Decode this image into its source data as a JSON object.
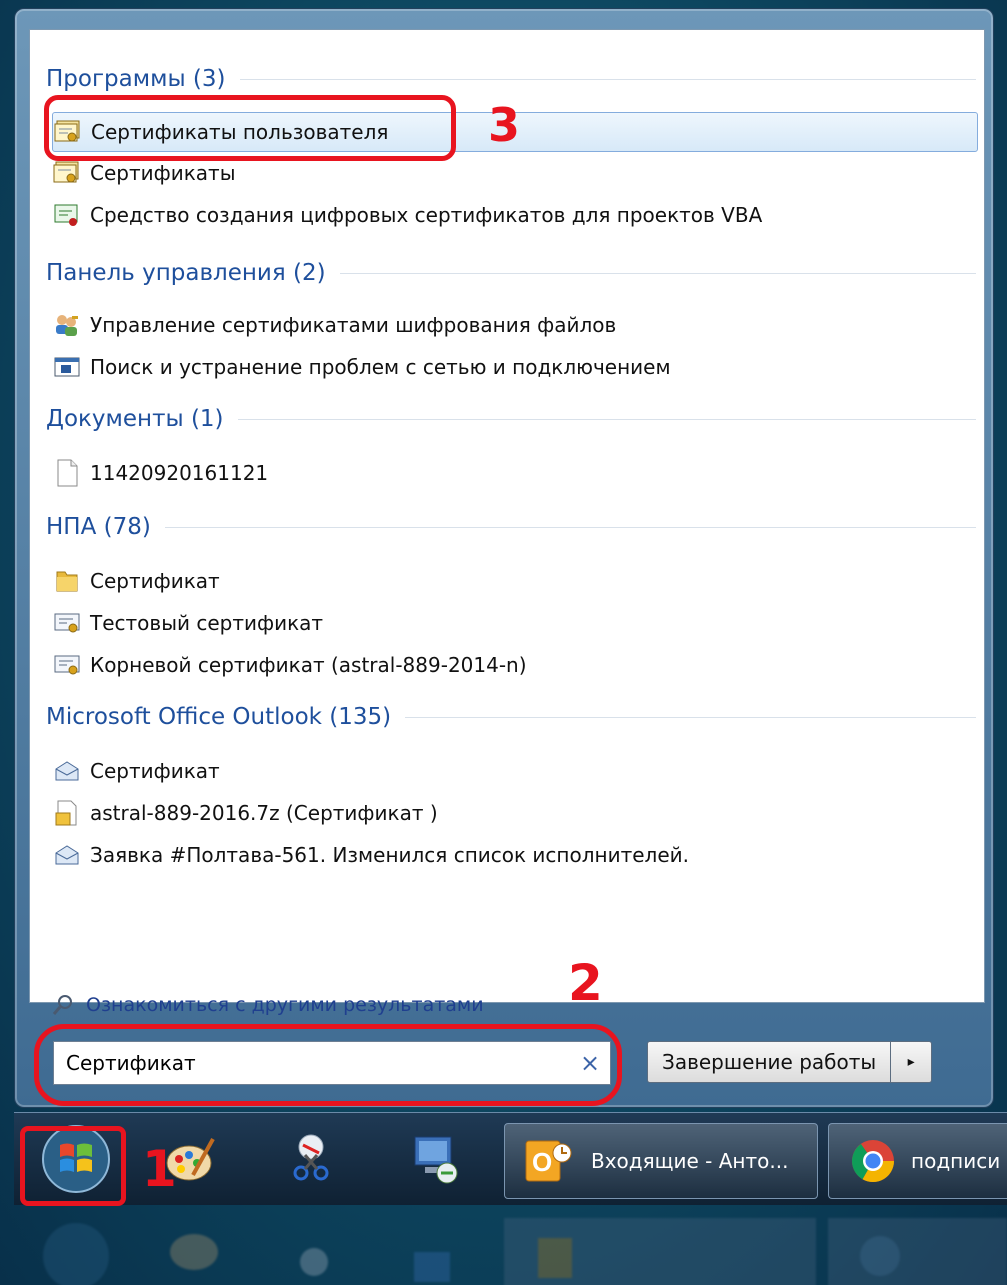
{
  "groups": [
    {
      "heading": "Программы (3)",
      "items": [
        {
          "label": "Сертификаты пользователя",
          "icon": "certificate-folder-icon",
          "selected": true
        },
        {
          "label": "Сертификаты",
          "icon": "certificate-folder-icon"
        },
        {
          "label": "Средство создания цифровых сертификатов для проектов VBA",
          "icon": "digital-certificate-icon"
        }
      ]
    },
    {
      "heading": "Панель управления (2)",
      "items": [
        {
          "label": "Управление сертификатами шифрования файлов",
          "icon": "users-key-icon"
        },
        {
          "label": "Поиск и устранение проблем с сетью и подключением",
          "icon": "network-troubleshoot-icon"
        }
      ]
    },
    {
      "heading": "Документы (1)",
      "items": [
        {
          "label": "11420920161121",
          "icon": "document-icon"
        }
      ]
    },
    {
      "heading": "НПА (78)",
      "items": [
        {
          "label": "Сертификат",
          "icon": "folder-icon"
        },
        {
          "label": "Тестовый сертификат",
          "icon": "certificate-icon"
        },
        {
          "label": "Корневой сертификат (astral-889-2014-n)",
          "icon": "certificate-icon"
        }
      ]
    },
    {
      "heading": "Microsoft Office Outlook (135)",
      "items": [
        {
          "label": "Сертификат",
          "icon": "email-icon"
        },
        {
          "label": "astral-889-2016.7z (Сертификат )",
          "icon": "archive-attachment-icon"
        },
        {
          "label": "Заявка #Полтава-561. Изменился список исполнителей.",
          "icon": "email-icon"
        }
      ]
    }
  ],
  "more_results": "Ознакомиться с другими результатами",
  "search": {
    "value": "Сертификат",
    "clear": "×"
  },
  "shutdown": {
    "label": "Завершение работы",
    "arrow": "▸"
  },
  "annotations": [
    "1",
    "2",
    "3"
  ],
  "taskbar": {
    "tasks": [
      {
        "label": "Входящие - Анто...",
        "icon": "outlook-icon"
      },
      {
        "label": "подписи",
        "icon": "chrome-icon"
      }
    ]
  },
  "colors": {
    "heading": "#1e4f9c",
    "link": "#1f3f8f",
    "annotation": "#e8141f",
    "selected_border": "#84acdd"
  }
}
